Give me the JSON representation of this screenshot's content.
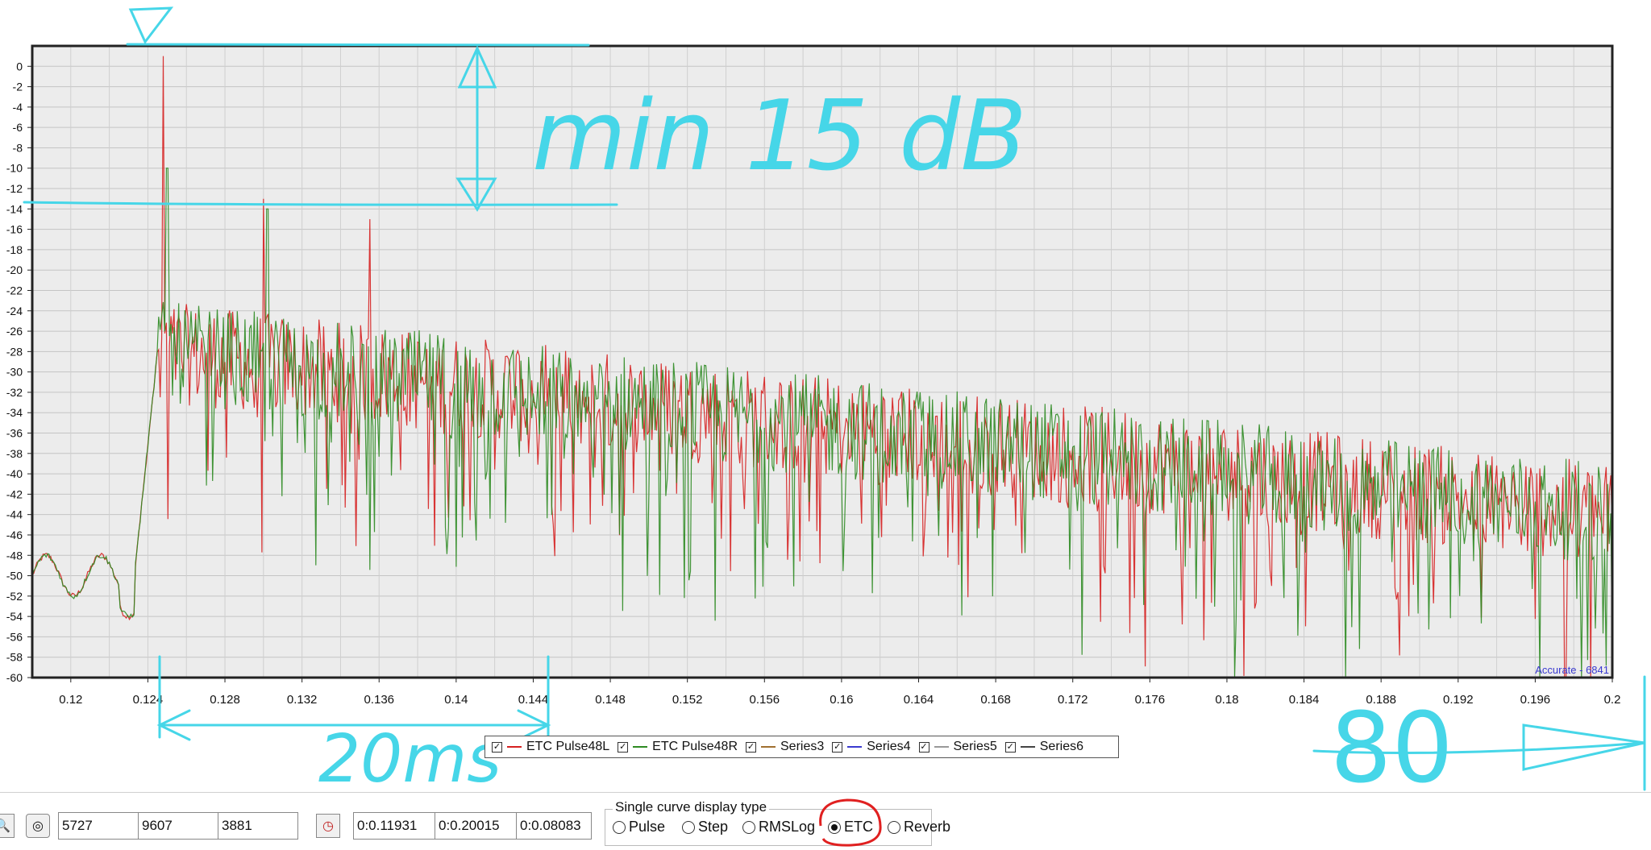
{
  "chart_data": {
    "type": "line",
    "xlim": [
      0.118,
      0.2
    ],
    "ylim": [
      -60,
      2
    ],
    "x_ticks": [
      "0.12",
      "0.124",
      "0.128",
      "0.132",
      "0.136",
      "0.14",
      "0.144",
      "0.148",
      "0.152",
      "0.156",
      "0.16",
      "0.164",
      "0.168",
      "0.172",
      "0.176",
      "0.18",
      "0.184",
      "0.188",
      "0.192",
      "0.196",
      "0.2"
    ],
    "y_ticks": [
      "0",
      "-2",
      "-4",
      "-6",
      "-8",
      "-10",
      "-12",
      "-14",
      "-16",
      "-18",
      "-20",
      "-22",
      "-24",
      "-26",
      "-28",
      "-30",
      "-32",
      "-34",
      "-36",
      "-38",
      "-40",
      "-42",
      "-44",
      "-46",
      "-48",
      "-50",
      "-52",
      "-54",
      "-56",
      "-58",
      "-60"
    ],
    "grid": true,
    "series": [
      {
        "name": "ETC Pulse48L",
        "color": "#d62020"
      },
      {
        "name": "ETC Pulse48R",
        "color": "#2e8b22"
      }
    ],
    "corner_label": "Accurate - 6841"
  },
  "legend": [
    {
      "label": "ETC Pulse48L",
      "color": "#d62020",
      "checked": true
    },
    {
      "label": "ETC Pulse48R",
      "color": "#2e8b22",
      "checked": true
    },
    {
      "label": "Series3",
      "color": "#a07030",
      "checked": true
    },
    {
      "label": "Series4",
      "color": "#3a3ad0",
      "checked": true
    },
    {
      "label": "Series5",
      "color": "#999999",
      "checked": true
    },
    {
      "label": "Series6",
      "color": "#444444",
      "checked": true
    }
  ],
  "toolbar": {
    "values": [
      "5727",
      "9607",
      "3881"
    ],
    "times": [
      "0:0.11931",
      "0:0.20015",
      "0:0.08083"
    ]
  },
  "display_type": {
    "title": "Single curve display type",
    "options": [
      "Pulse",
      "Step",
      "RMSLog",
      "ETC",
      "Reverb"
    ],
    "selected": "ETC"
  },
  "annotations": {
    "level": "min 15 dB",
    "width": "20ms",
    "span": "80"
  },
  "accent_cyan": "#46d6e8",
  "accent_red": "#e02020"
}
